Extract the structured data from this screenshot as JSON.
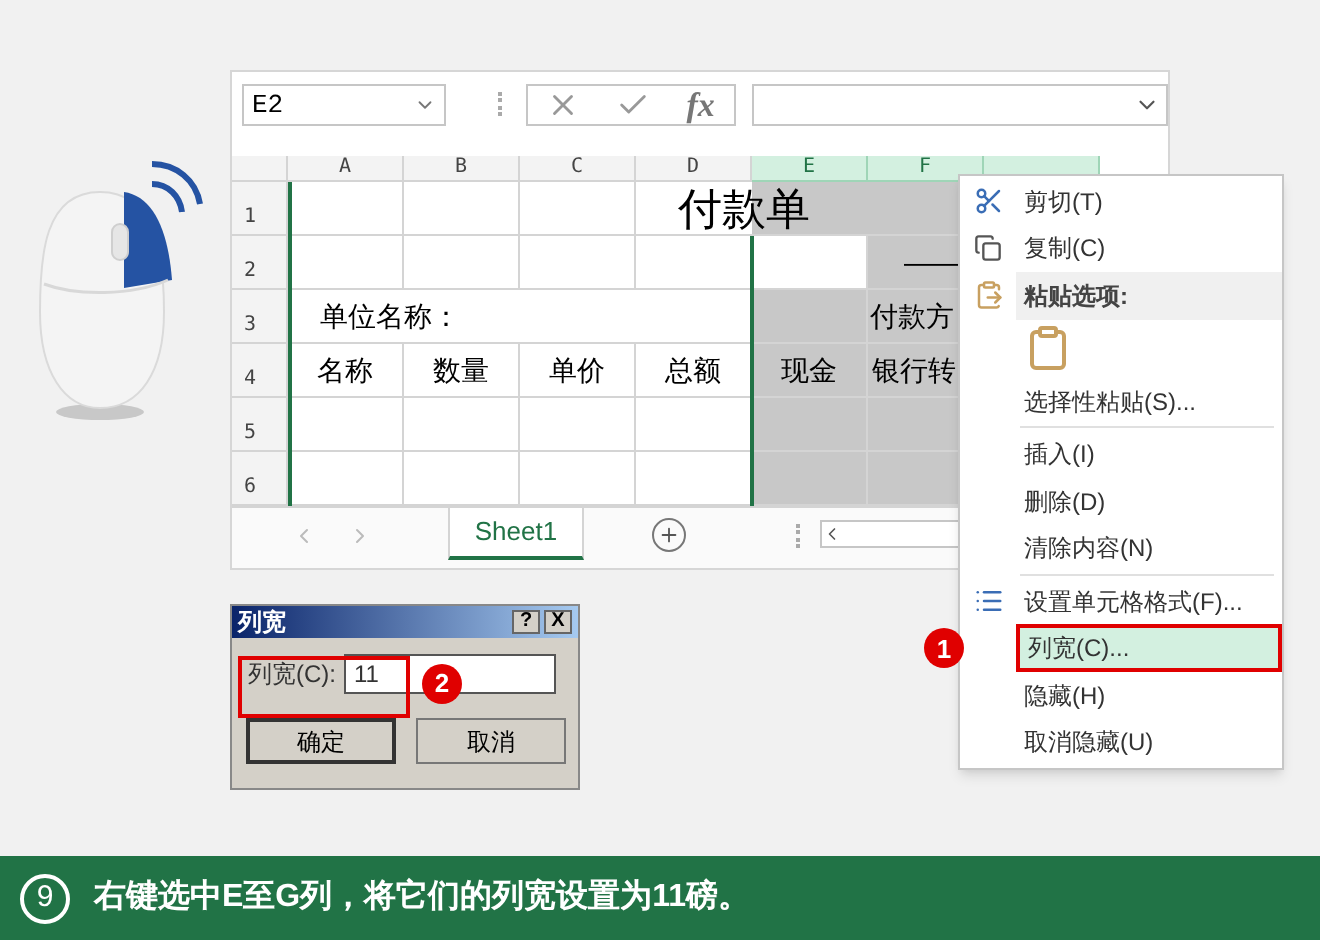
{
  "spreadsheet": {
    "name_box": "E2",
    "function_label": "fx",
    "columns": [
      {
        "label": "A",
        "selected": false
      },
      {
        "label": "B",
        "selected": false
      },
      {
        "label": "C",
        "selected": false
      },
      {
        "label": "D",
        "selected": false
      },
      {
        "label": "E",
        "selected": true
      },
      {
        "label": "F",
        "selected": true
      },
      {
        "selected": true
      }
    ],
    "rows": [
      {
        "number": "1",
        "cells": [
          {},
          {},
          {},
          {
            "kind": "title",
            "text": "付款单"
          },
          {
            "merged": true
          },
          {
            "merged": true
          },
          {
            "merged": true
          }
        ]
      },
      {
        "number": "2",
        "cells": [
          {},
          {},
          {},
          {},
          {
            "active": true
          },
          {
            "kind": "rule",
            "text": "——"
          }
        ]
      },
      {
        "number": "3",
        "cells": [
          {
            "kind": "label",
            "text": "单位名称："
          },
          {
            "merged": true
          },
          {
            "merged": true
          },
          {
            "merged": true
          },
          {},
          {
            "kind": "group",
            "text": "付款方"
          },
          {
            "merged": true
          }
        ]
      },
      {
        "number": "4",
        "cells": [
          {
            "kind": "header",
            "text": "名称"
          },
          {
            "kind": "header",
            "text": "数量"
          },
          {
            "kind": "header",
            "text": "单价"
          },
          {
            "kind": "header",
            "text": "总额"
          },
          {
            "kind": "header",
            "text": "现金"
          },
          {
            "kind": "cut",
            "text": "银行转"
          }
        ]
      },
      {
        "number": "5",
        "cells": [
          {},
          {},
          {},
          {},
          {},
          {}
        ]
      },
      {
        "number": "6",
        "cells": [
          {},
          {},
          {},
          {},
          {},
          {}
        ]
      }
    ],
    "sheet_tabs": [
      {
        "label": "Sheet1",
        "selected": true
      }
    ]
  },
  "context_menu": {
    "callout": "1",
    "items": [
      {
        "kind": "cut",
        "label": "剪切(T)",
        "selected": false
      },
      {
        "kind": "copy",
        "label": "复制(C)",
        "selected": false
      },
      {
        "kind": "paste_header",
        "label": "粘贴选项:",
        "selected": false
      },
      {
        "kind": "paste_option",
        "selected": false
      },
      {
        "kind": "command",
        "label": "选择性粘贴(S)...",
        "selected": false,
        "divider_after": true
      },
      {
        "kind": "command",
        "label": "插入(I)",
        "selected": false
      },
      {
        "kind": "command",
        "label": "删除(D)",
        "selected": false
      },
      {
        "kind": "command",
        "label": "清除内容(N)",
        "selected": false,
        "divider_after": true
      },
      {
        "kind": "format",
        "label": "设置单元格格式(F)...",
        "selected": false
      },
      {
        "kind": "command",
        "label": "列宽(C)...",
        "selected": true
      },
      {
        "kind": "command",
        "label": "隐藏(H)",
        "selected": false
      },
      {
        "kind": "command",
        "label": "取消隐藏(U)",
        "selected": false
      }
    ]
  },
  "dialog": {
    "title": "列宽",
    "title_buttons": [
      "?",
      "X"
    ],
    "field_label": "列宽(C):",
    "field_value": "11",
    "callout": "2",
    "buttons": [
      "确定",
      "取消"
    ]
  },
  "caption": {
    "step": "9",
    "text": "右键选中E至G列，将它们的列宽设置为11磅。"
  }
}
